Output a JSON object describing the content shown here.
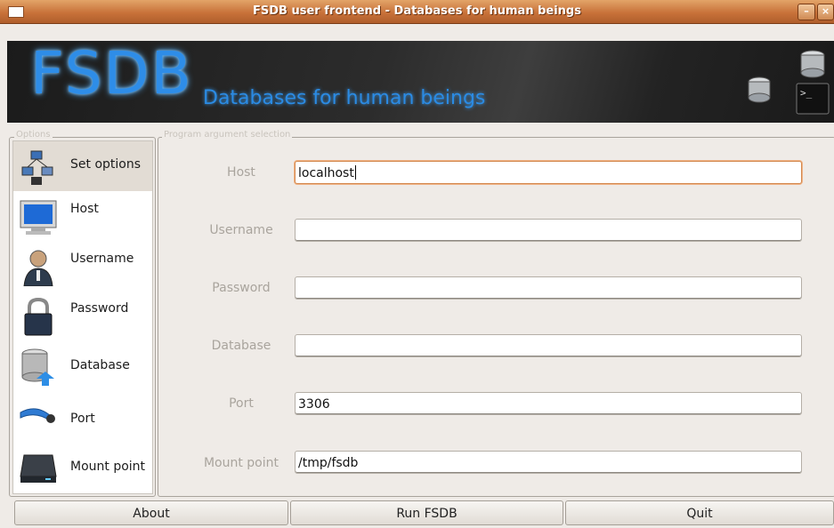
{
  "window": {
    "title": "FSDB user frontend - Databases for human beings"
  },
  "banner": {
    "logo": "FSDB",
    "tagline": "Databases for human beings"
  },
  "legends": {
    "left": "Options",
    "right": "Program argument selection"
  },
  "sidebar": {
    "items": [
      {
        "label": "Set options",
        "icon": "network-settings-icon",
        "selected": true
      },
      {
        "label": "Host",
        "icon": "monitor-icon",
        "selected": false
      },
      {
        "label": "Username",
        "icon": "user-icon",
        "selected": false
      },
      {
        "label": "Password",
        "icon": "padlock-icon",
        "selected": false
      },
      {
        "label": "Database",
        "icon": "database-icon",
        "selected": false
      },
      {
        "label": "Port",
        "icon": "network-port-icon",
        "selected": false
      },
      {
        "label": "Mount point",
        "icon": "hard-drive-icon",
        "selected": false
      }
    ]
  },
  "form": {
    "fields": [
      {
        "label": "Host",
        "value": "localhost"
      },
      {
        "label": "Username",
        "value": ""
      },
      {
        "label": "Password",
        "value": ""
      },
      {
        "label": "Database",
        "value": ""
      },
      {
        "label": "Port",
        "value": "3306"
      },
      {
        "label": "Mount point",
        "value": "/tmp/fsdb"
      }
    ]
  },
  "buttons": {
    "about": "About",
    "run": "Run FSDB",
    "quit": "Quit"
  },
  "colors": {
    "titlebar": "#c8723a",
    "accent_blue": "#2e8de8",
    "focus": "#d3894f"
  }
}
